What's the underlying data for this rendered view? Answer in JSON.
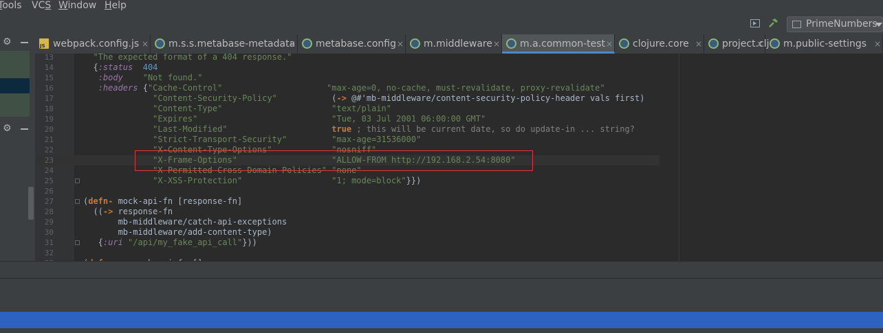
{
  "menu": [
    {
      "pre": "",
      "u": "T",
      "post": "ools",
      "label": "Tools"
    },
    {
      "pre": "VC",
      "u": "S",
      "post": "",
      "label": "VCS"
    },
    {
      "pre": "",
      "u": "W",
      "post": "indow",
      "label": "Window"
    },
    {
      "pre": "",
      "u": "H",
      "post": "elp",
      "label": "Help"
    }
  ],
  "toolbar": {
    "run_configuration": "PrimeNumbers"
  },
  "tabs": [
    {
      "label": "webpack.config.js",
      "icon": "js-file-icon"
    },
    {
      "label": "m.s.s.metabase-metadata",
      "icon": "clojure-file-icon"
    },
    {
      "label": "metabase.config",
      "icon": "clojure-file-icon"
    },
    {
      "label": "m.middleware",
      "icon": "clojure-file-icon"
    },
    {
      "label": "m.a.common-test",
      "icon": "clojure-file-icon",
      "active": true
    },
    {
      "label": "clojure.core",
      "icon": "clojure-file-icon"
    },
    {
      "label": "project.clj",
      "icon": "clojure-file-icon"
    },
    {
      "label": "m.public-settings",
      "icon": "clojure-file-icon"
    }
  ],
  "close_glyph": "×",
  "code_lines": [
    {
      "n": "13",
      "segs": [
        [
          "s",
          "  \"The expected format of a 404 response.\""
        ]
      ]
    },
    {
      "n": "14",
      "segs": [
        [
          "p",
          "  {"
        ],
        [
          "k",
          ":status"
        ],
        [
          "p",
          "  "
        ],
        [
          "n",
          "404"
        ]
      ]
    },
    {
      "n": "15",
      "segs": [
        [
          "p",
          "   "
        ],
        [
          "k",
          ":body"
        ],
        [
          "p",
          "    "
        ],
        [
          "s",
          "\"Not found.\""
        ]
      ]
    },
    {
      "n": "16",
      "segs": [
        [
          "p",
          "   "
        ],
        [
          "k",
          ":headers"
        ],
        [
          "p",
          " {"
        ],
        [
          "s",
          "\"Cache-Control\""
        ],
        [
          "p",
          "                     "
        ],
        [
          "s",
          "\"max-age=0, no-cache, must-revalidate, proxy-revalidate\""
        ]
      ]
    },
    {
      "n": "17",
      "segs": [
        [
          "p",
          "              "
        ],
        [
          "s",
          "\"Content-Security-Policy\""
        ],
        [
          "p",
          "           ("
        ],
        [
          "m",
          "->"
        ],
        [
          "p",
          " @#'mb-middleware/content-security-policy-header vals first)"
        ]
      ]
    },
    {
      "n": "18",
      "segs": [
        [
          "p",
          "              "
        ],
        [
          "s",
          "\"Content-Type\""
        ],
        [
          "p",
          "                      "
        ],
        [
          "s",
          "\"text/plain\""
        ]
      ]
    },
    {
      "n": "19",
      "segs": [
        [
          "p",
          "              "
        ],
        [
          "s",
          "\"Expires\""
        ],
        [
          "p",
          "                           "
        ],
        [
          "s",
          "\"Tue, 03 Jul 2001 06:00:00 GMT\""
        ]
      ]
    },
    {
      "n": "20",
      "segs": [
        [
          "p",
          "              "
        ],
        [
          "s",
          "\"Last-Modified\""
        ],
        [
          "p",
          "                     "
        ],
        [
          "m",
          "true"
        ],
        [
          "c",
          " ; this will be current date, so do update-in ... string?"
        ]
      ]
    },
    {
      "n": "21",
      "segs": [
        [
          "p",
          "              "
        ],
        [
          "s",
          "\"Strict-Transport-Security\""
        ],
        [
          "p",
          "         "
        ],
        [
          "s",
          "\"max-age=31536000\""
        ]
      ]
    },
    {
      "n": "22",
      "segs": [
        [
          "p",
          "              "
        ],
        [
          "s",
          "\"X-Content-Type-Options\""
        ],
        [
          "p",
          "            "
        ],
        [
          "s",
          "\"nosniff\""
        ]
      ]
    },
    {
      "n": "23",
      "segs": [
        [
          "p",
          "              "
        ],
        [
          "s",
          "\"X-Frame-Options\""
        ],
        [
          "p",
          "                   "
        ],
        [
          "s",
          "\"ALLOW-FROM http://192.168.2.54:8080\""
        ]
      ],
      "current": true
    },
    {
      "n": "24",
      "segs": [
        [
          "p",
          "              "
        ],
        [
          "s",
          "\"X-Permitted-Cross-Domain-Policies\""
        ],
        [
          "p",
          " "
        ],
        [
          "s",
          "\"none\""
        ]
      ]
    },
    {
      "n": "25",
      "segs": [
        [
          "p",
          "              "
        ],
        [
          "s",
          "\"X-XSS-Protection\""
        ],
        [
          "p",
          "                  "
        ],
        [
          "s",
          "\"1; mode=block\""
        ],
        [
          "p",
          "}})"
        ]
      ],
      "fold": true
    },
    {
      "n": "26",
      "segs": []
    },
    {
      "n": "27",
      "segs": [
        [
          "p",
          "("
        ],
        [
          "m",
          "defn-"
        ],
        [
          "p",
          " mock-api-fn [response-fn]"
        ]
      ],
      "fold": true
    },
    {
      "n": "28",
      "segs": [
        [
          "p",
          "  (("
        ],
        [
          "m",
          "->"
        ],
        [
          "p",
          " response-fn"
        ]
      ]
    },
    {
      "n": "29",
      "segs": [
        [
          "p",
          "       mb-middleware/catch-api-exceptions"
        ]
      ]
    },
    {
      "n": "30",
      "segs": [
        [
          "p",
          "       mb-middleware/add-content-type)"
        ]
      ]
    },
    {
      "n": "31",
      "segs": [
        [
          "p",
          "   {"
        ],
        [
          "k",
          ":uri"
        ],
        [
          "p",
          " "
        ],
        [
          "s",
          "\"/api/my_fake_api_call\""
        ],
        [
          "p",
          "}))"
        ]
      ],
      "fold": true
    },
    {
      "n": "32",
      "segs": []
    },
    {
      "n": "33",
      "segs": [
        [
          "p",
          "("
        ],
        [
          "m",
          "defn-"
        ],
        [
          "p",
          " my-mock-api-fn []"
        ]
      ]
    }
  ]
}
